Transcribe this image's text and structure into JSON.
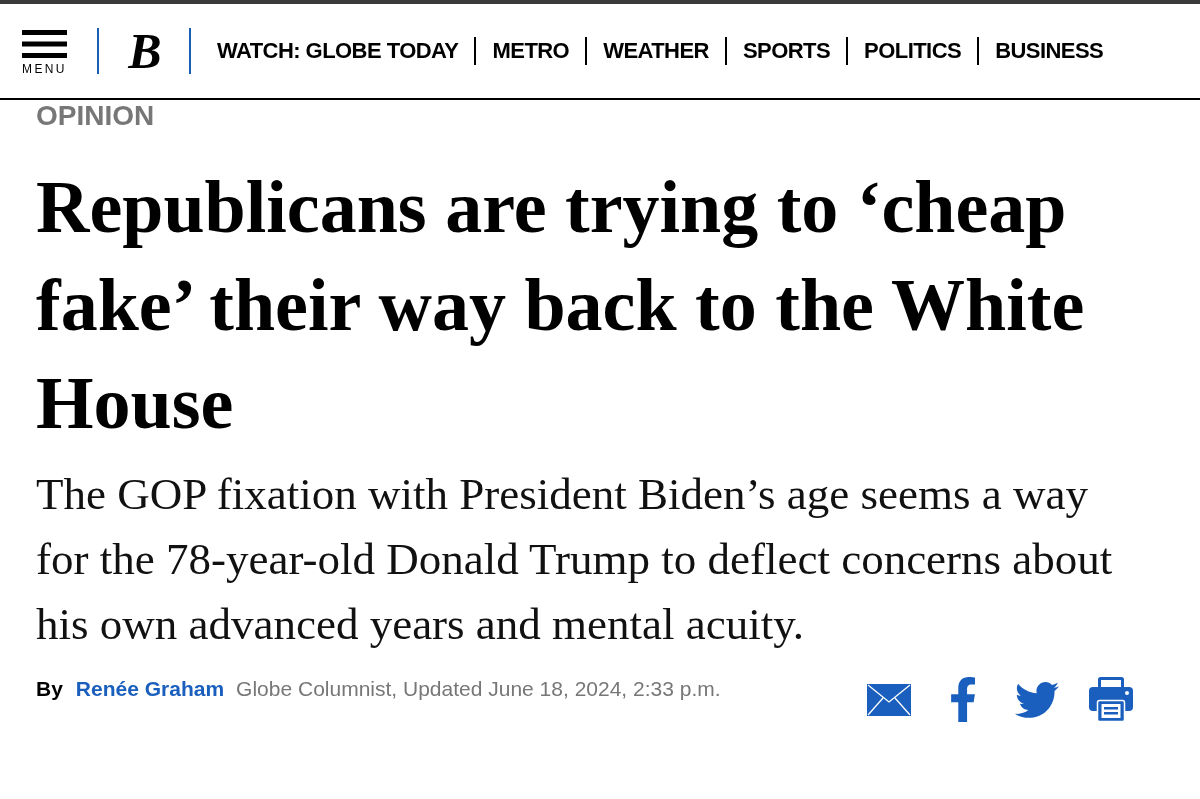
{
  "header": {
    "menu_label": "MENU",
    "logo": "B",
    "nav": [
      "WATCH: GLOBE TODAY",
      "METRO",
      "WEATHER",
      "SPORTS",
      "POLITICS",
      "BUSINESS"
    ]
  },
  "article": {
    "section": "OPINION",
    "headline": "Republicans are trying to ‘cheap fake’ their way back to the White House",
    "dek": "The GOP fixation with President Biden’s age seems a way for the 78-year-old Donald Trump to deflect concerns about his own advanced years and mental acuity.",
    "byline": {
      "prefix": "By",
      "author": "Renée Graham",
      "meta": "Globe Columnist, Updated June 18, 2024, 2:33 p.m."
    }
  }
}
